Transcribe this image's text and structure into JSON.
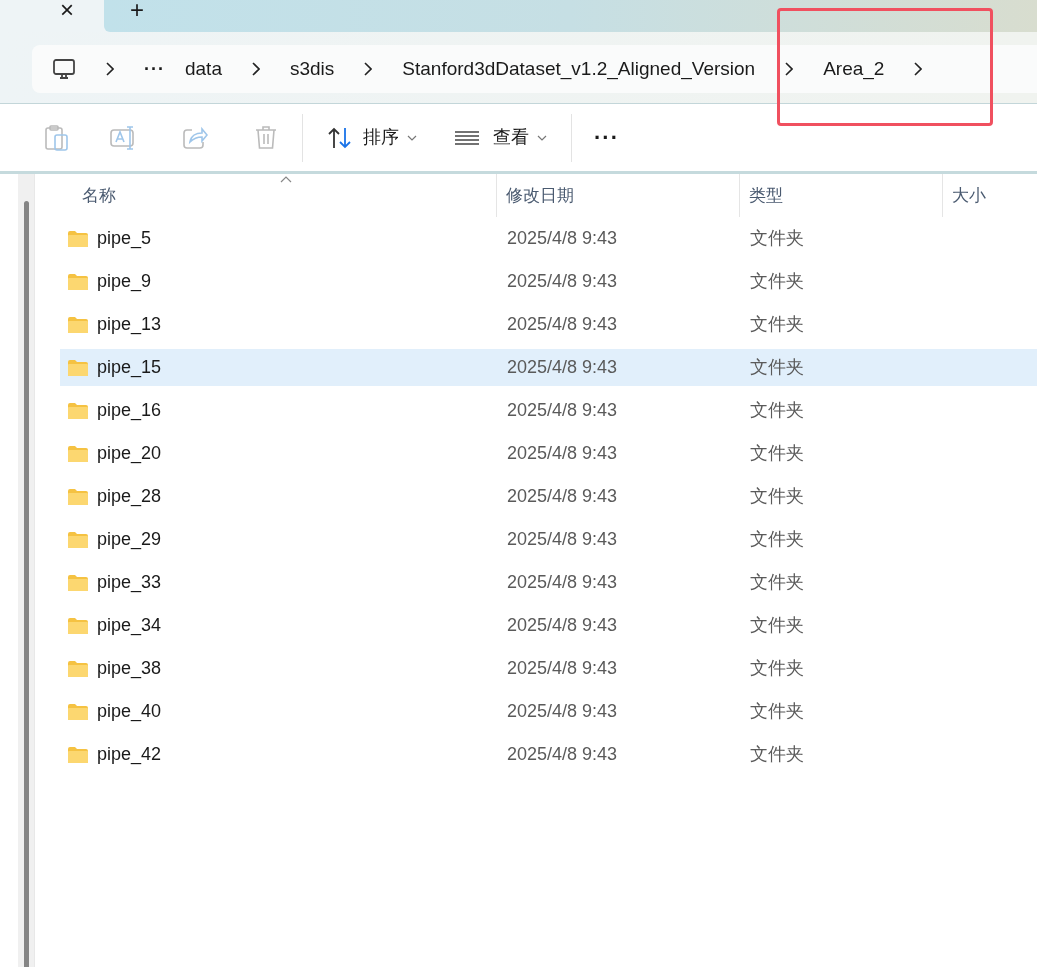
{
  "tabs": {
    "close_glyph": "×",
    "new_tab_glyph": "+"
  },
  "breadcrumb": {
    "overflow": "···",
    "items": [
      "data",
      "s3dis",
      "Stanford3dDataset_v1.2_Aligned_Version",
      "Area_2"
    ]
  },
  "toolbar": {
    "sort": "排序",
    "view": "查看",
    "more": "···"
  },
  "table": {
    "columns": [
      "名称",
      "修改日期",
      "类型",
      "大小"
    ],
    "rows": [
      {
        "name": "pipe_5",
        "modified": "2025/4/8 9:43",
        "type": "文件夹",
        "selected": false
      },
      {
        "name": "pipe_9",
        "modified": "2025/4/8 9:43",
        "type": "文件夹",
        "selected": false
      },
      {
        "name": "pipe_13",
        "modified": "2025/4/8 9:43",
        "type": "文件夹",
        "selected": false
      },
      {
        "name": "pipe_15",
        "modified": "2025/4/8 9:43",
        "type": "文件夹",
        "selected": true
      },
      {
        "name": "pipe_16",
        "modified": "2025/4/8 9:43",
        "type": "文件夹",
        "selected": false
      },
      {
        "name": "pipe_20",
        "modified": "2025/4/8 9:43",
        "type": "文件夹",
        "selected": false
      },
      {
        "name": "pipe_28",
        "modified": "2025/4/8 9:43",
        "type": "文件夹",
        "selected": false
      },
      {
        "name": "pipe_29",
        "modified": "2025/4/8 9:43",
        "type": "文件夹",
        "selected": false
      },
      {
        "name": "pipe_33",
        "modified": "2025/4/8 9:43",
        "type": "文件夹",
        "selected": false
      },
      {
        "name": "pipe_34",
        "modified": "2025/4/8 9:43",
        "type": "文件夹",
        "selected": false
      },
      {
        "name": "pipe_38",
        "modified": "2025/4/8 9:43",
        "type": "文件夹",
        "selected": false
      },
      {
        "name": "pipe_40",
        "modified": "2025/4/8 9:43",
        "type": "文件夹",
        "selected": false
      },
      {
        "name": "pipe_42",
        "modified": "2025/4/8 9:43",
        "type": "文件夹",
        "selected": false
      }
    ]
  }
}
